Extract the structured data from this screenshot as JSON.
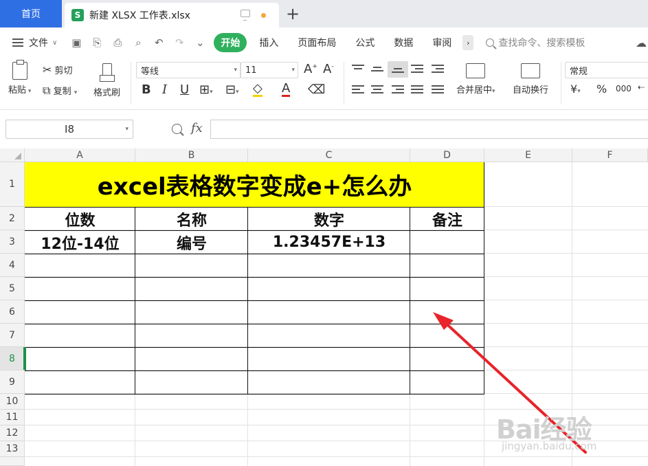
{
  "titlebar": {
    "home_tab": "首页",
    "doc_icon": "S",
    "doc_name": "新建 XLSX 工作表.xlsx",
    "new_tab": "+"
  },
  "menubar": {
    "file_label": "文件",
    "tabs": [
      "开始",
      "插入",
      "页面布局",
      "公式",
      "数据",
      "审阅"
    ],
    "more": "›",
    "search_placeholder": "查找命令、搜索模板"
  },
  "ribbon": {
    "paste": "粘贴",
    "cut": "剪切",
    "copy": "复制",
    "format_painter": "格式刷",
    "font_name": "等线",
    "font_size": "11",
    "bold": "B",
    "italic": "I",
    "underline": "U",
    "font_color_letter": "A",
    "merge_center": "合并居中",
    "wrap_text": "自动换行",
    "number_format": "常规",
    "currency": "¥",
    "percent": "%",
    "thousands": "000"
  },
  "formulabar": {
    "name_box": "I8",
    "fx": "fx",
    "formula": ""
  },
  "grid": {
    "columns": [
      "A",
      "B",
      "C",
      "D",
      "E",
      "F"
    ],
    "rows": [
      "1",
      "2",
      "3",
      "4",
      "5",
      "6",
      "7",
      "8",
      "9",
      "10",
      "11",
      "12",
      "13"
    ],
    "active_row": "8",
    "title": "excel表格数字变成e+怎么办",
    "headers": [
      "位数",
      "名称",
      "数字",
      "备注"
    ],
    "row3": [
      "12位-14位",
      "编号",
      "1.23457E+13",
      ""
    ]
  },
  "watermark": {
    "brand": "Bai经验",
    "url": "jingyan.baidu.com"
  },
  "colors": {
    "accent_blue": "#2f6fe4",
    "accent_green": "#2fb05c",
    "title_fill": "#ffff00",
    "arrow_red": "#e8232a"
  }
}
